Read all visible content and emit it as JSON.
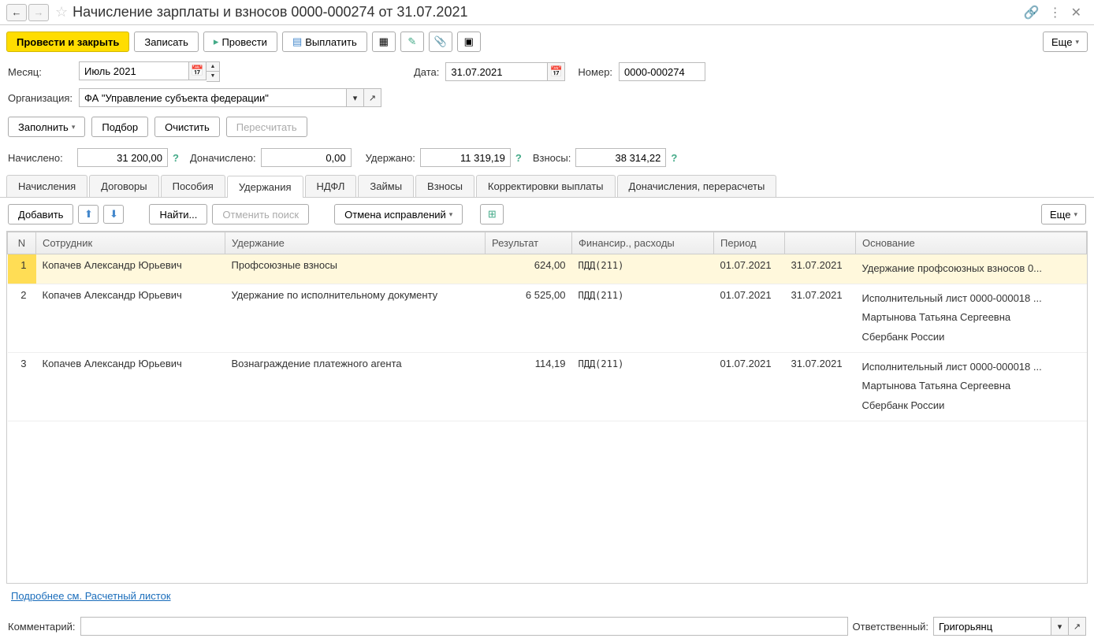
{
  "title": "Начисление зарплаты и взносов 0000-000274 от 31.07.2021",
  "toolbar": {
    "post_close": "Провести и закрыть",
    "save": "Записать",
    "post": "Провести",
    "payout": "Выплатить",
    "more": "Еще"
  },
  "fields": {
    "month_label": "Месяц:",
    "month_value": "Июль 2021",
    "date_label": "Дата:",
    "date_value": "31.07.2021",
    "number_label": "Номер:",
    "number_value": "0000-000274",
    "org_label": "Организация:",
    "org_value": "ФА \"Управление субъекта федерации\""
  },
  "actions": {
    "fill": "Заполнить",
    "select": "Подбор",
    "clear": "Очистить",
    "recalc": "Пересчитать"
  },
  "summary": {
    "accrued_label": "Начислено:",
    "accrued_value": "31 200,00",
    "extra_label": "Доначислено:",
    "extra_value": "0,00",
    "withheld_label": "Удержано:",
    "withheld_value": "11 319,19",
    "contrib_label": "Взносы:",
    "contrib_value": "38 314,22"
  },
  "tabs": {
    "t0": "Начисления",
    "t1": "Договоры",
    "t2": "Пособия",
    "t3": "Удержания",
    "t4": "НДФЛ",
    "t5": "Займы",
    "t6": "Взносы",
    "t7": "Корректировки выплаты",
    "t8": "Доначисления, перерасчеты"
  },
  "tabtoolbar": {
    "add": "Добавить",
    "find": "Найти...",
    "cancel_find": "Отменить поиск",
    "cancel_fix": "Отмена исправлений",
    "more": "Еще"
  },
  "columns": {
    "n": "N",
    "employee": "Сотрудник",
    "deduction": "Удержание",
    "result": "Результат",
    "finance": "Финансир., расходы",
    "period": "Период",
    "basis": "Основание"
  },
  "rows": [
    {
      "n": "1",
      "employee": "Копачев Александр Юрьевич",
      "deduction": "Профсоюзные взносы",
      "result": "624,00",
      "finance": "ПДД(211)",
      "period_from": "01.07.2021",
      "period_to": "31.07.2021",
      "basis": [
        "Удержание профсоюзных взносов 0..."
      ]
    },
    {
      "n": "2",
      "employee": "Копачев Александр Юрьевич",
      "deduction": "Удержание по исполнительному документу",
      "result": "6 525,00",
      "finance": "ПДД(211)",
      "period_from": "01.07.2021",
      "period_to": "31.07.2021",
      "basis": [
        "Исполнительный лист 0000-000018 ...",
        "Мартынова Татьяна Сергеевна",
        "Сбербанк России"
      ]
    },
    {
      "n": "3",
      "employee": "Копачев Александр Юрьевич",
      "deduction": "Вознаграждение платежного агента",
      "result": "114,19",
      "finance": "ПДД(211)",
      "period_from": "01.07.2021",
      "period_to": "31.07.2021",
      "basis": [
        "Исполнительный лист 0000-000018 ...",
        "Мартынова Татьяна Сергеевна",
        "Сбербанк России"
      ]
    }
  ],
  "link": "Подробнее см. Расчетный листок",
  "footer": {
    "comment_label": "Комментарий:",
    "comment_value": "",
    "resp_label": "Ответственный:",
    "resp_value": "Григорьянц"
  }
}
